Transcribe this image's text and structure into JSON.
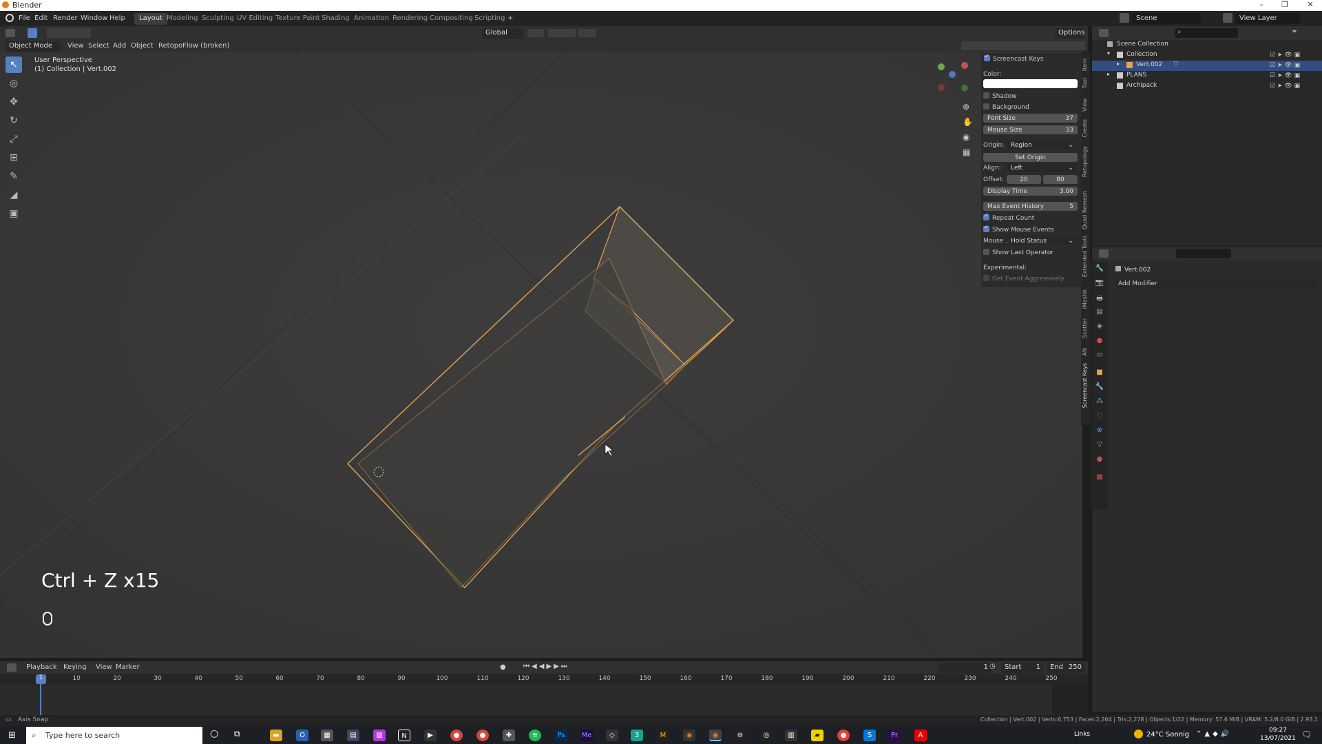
{
  "window": {
    "title": "Blender"
  },
  "menu": [
    "File",
    "Edit",
    "Render",
    "Window",
    "Help"
  ],
  "workspaces": [
    "Layout",
    "Modeling",
    "Sculpting",
    "UV Editing",
    "Texture Paint",
    "Shading",
    "Animation",
    "Rendering",
    "Compositing",
    "Scripting"
  ],
  "active_workspace": "Layout",
  "scene": {
    "scene_label": "Scene",
    "view_layer_label": "View Layer"
  },
  "viewport_header": {
    "mode": "Object Mode",
    "menus": [
      "View",
      "Select",
      "Add",
      "Object"
    ],
    "addon_menu": "RetopoFlow (broken)",
    "orientation": "Global",
    "options": "Options"
  },
  "viewport": {
    "perspective": "User Perspective",
    "context": "(1) Collection | Vert.002",
    "keys_overlay": "Ctrl + Z x15"
  },
  "npanel": {
    "header": "Screencast Keys",
    "color_label": "Color:",
    "shadow_label": "Shadow",
    "background_label": "Background",
    "font_size_label": "Font Size",
    "font_size": "37",
    "mouse_size_label": "Mouse Size",
    "mouse_size": "33",
    "origin_label": "Origin:",
    "origin_value": "Region",
    "set_origin": "Set Origin",
    "align_label": "Align:",
    "align_value": "Left",
    "offset_label": "Offset:",
    "offset_x": "20",
    "offset_y": "80",
    "display_time_label": "Display Time",
    "display_time": "3.00",
    "max_event_label": "Max Event History",
    "max_event": "5",
    "repeat_count": "Repeat Count",
    "show_mouse_events": "Show Mouse Events",
    "mouse_label": "Mouse ...",
    "mouse_value": "Hold Status",
    "show_last_operator": "Show Last Operator",
    "experimental_label": "Experimental:",
    "get_event_aggr": "Get Event Aggressively"
  },
  "sidetabs": [
    "Item",
    "Tool",
    "View",
    "Create",
    "Retopology",
    "Quad Remesh",
    "Extended Tools",
    "iMeshh",
    "Scatter",
    "AN",
    "Screencast Keys"
  ],
  "outliner": {
    "rows": [
      {
        "label": "Scene Collection",
        "indent": 0
      },
      {
        "label": "Collection",
        "indent": 1
      },
      {
        "label": "Vert.002",
        "indent": 2
      },
      {
        "label": "PLANS",
        "indent": 1
      },
      {
        "label": "Archipack",
        "indent": 1
      }
    ],
    "selected_index": 2
  },
  "properties": {
    "object_name": "Vert.002",
    "add_modifier": "Add Modifier"
  },
  "timeline": {
    "menus": [
      "Playback",
      "Keying",
      "View",
      "Marker"
    ],
    "current_frame": "1",
    "start_label": "Start",
    "start": "1",
    "end_label": "End",
    "end": "250",
    "ticks": [
      "1",
      "10",
      "20",
      "30",
      "40",
      "50",
      "60",
      "70",
      "80",
      "90",
      "100",
      "110",
      "120",
      "130",
      "140",
      "150",
      "160",
      "170",
      "180",
      "190",
      "200",
      "210",
      "220",
      "230",
      "240",
      "250"
    ]
  },
  "statusbar": {
    "left": "Axis Snap",
    "right": "Collection | Vert.002 | Verts:6,753 | Faces:2,264 | Tris:2,278 | Objects:1/22 | Memory: 57.6 MiB | VRAM: 5.2/8.0 GiB | 2.93.1"
  },
  "taskbar": {
    "search_placeholder": "Type here to search",
    "links": "Links",
    "weather": "24°C Sonnig",
    "time": "09:27",
    "date": "13/07/2021"
  },
  "colors": {
    "accent": "#5680c2",
    "selection_outline": "#e8a24a",
    "viewport_bg": "#3a3a3a"
  }
}
